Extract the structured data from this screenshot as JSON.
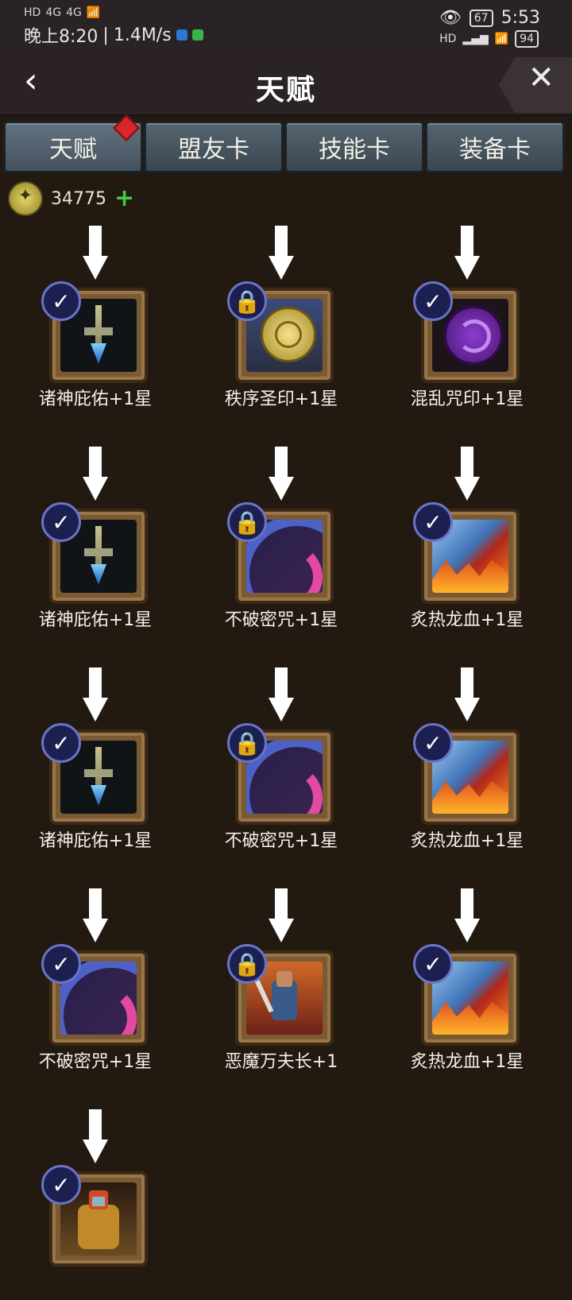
{
  "status": {
    "time_left": "晚上8:20",
    "speed": "1.4M/s",
    "network1": "4G",
    "network2": "4G",
    "hd": "HD",
    "time_right": "5:53",
    "badge67": "67",
    "battery": "94",
    "hd2": "HD"
  },
  "header": {
    "back": "‹",
    "title": "天赋",
    "close": "✕"
  },
  "tabs": [
    {
      "label": "天赋"
    },
    {
      "label": "盟友卡"
    },
    {
      "label": "技能卡"
    },
    {
      "label": "装备卡"
    }
  ],
  "currency": {
    "value": "34775",
    "plus": "+"
  },
  "nodes": [
    {
      "label": "诸神庇佑+1星",
      "state": "✓",
      "art": "blade"
    },
    {
      "label": "秩序圣印+1星",
      "state": "🔒",
      "art": "coin"
    },
    {
      "label": "混乱咒印+1星",
      "state": "✓",
      "art": "chaos"
    },
    {
      "label": "诸神庇佑+1星",
      "state": "✓",
      "art": "blade"
    },
    {
      "label": "不破密咒+1星",
      "state": "🔒",
      "art": "curse"
    },
    {
      "label": "炙热龙血+1星",
      "state": "✓",
      "art": "fire"
    },
    {
      "label": "诸神庇佑+1星",
      "state": "✓",
      "art": "blade"
    },
    {
      "label": "不破密咒+1星",
      "state": "🔒",
      "art": "curse"
    },
    {
      "label": "炙热龙血+1星",
      "state": "✓",
      "art": "fire"
    },
    {
      "label": "不破密咒+1星",
      "state": "✓",
      "art": "curse"
    },
    {
      "label": "恶魔万夫长+1",
      "state": "🔒",
      "art": "demon"
    },
    {
      "label": "炙热龙血+1星",
      "state": "✓",
      "art": "fire"
    },
    {
      "label": "",
      "state": "✓",
      "art": "warrior"
    }
  ]
}
